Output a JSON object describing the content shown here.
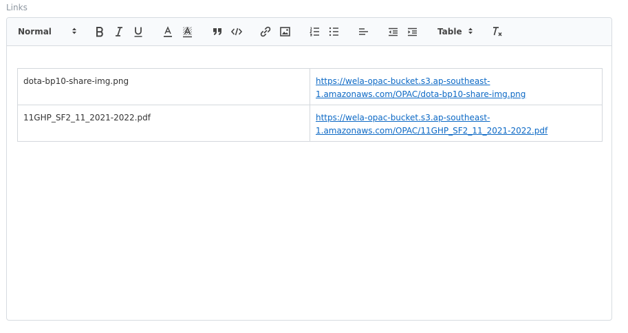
{
  "field": {
    "label": "Links"
  },
  "toolbar": {
    "header_picker": {
      "value": "Normal",
      "icon": "updown-arrows-icon"
    },
    "table_picker": {
      "value": "Table",
      "icon": "updown-arrows-icon"
    },
    "buttons": [
      "bold-icon",
      "italic-icon",
      "underline-icon",
      "text-color-icon",
      "background-color-icon",
      "blockquote-icon",
      "code-icon",
      "link-icon",
      "image-icon",
      "ordered-list-icon",
      "bullet-list-icon",
      "align-left-icon",
      "outdent-icon",
      "indent-icon",
      "clear-format-icon"
    ]
  },
  "table": {
    "rows": [
      {
        "name": "dota-bp10-share-img.png",
        "url_line1": "https://wela-opac-bucket.s3.ap-southeast-",
        "url_line2": "1.amazonaws.com/OPAC/dota-bp10-share-img.png"
      },
      {
        "name": "11GHP_SF2_11_2021-2022.pdf",
        "url_line1": "https://wela-opac-bucket.s3.ap-southeast-",
        "url_line2": "1.amazonaws.com/OPAC/11GHP_SF2_11_2021-2022.pdf"
      }
    ]
  },
  "colors": {
    "link": "#0b68c5",
    "toolbar_bg": "#f8fafc",
    "border": "#d6dbe0",
    "label": "#8d96a0"
  }
}
